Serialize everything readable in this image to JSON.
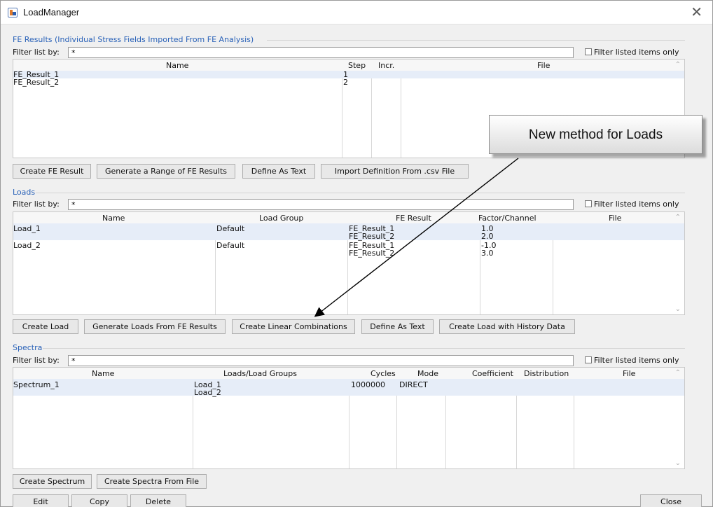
{
  "window": {
    "title": "LoadManager"
  },
  "common": {
    "filter_label": "Filter list by:",
    "filter_value": "*",
    "filter_checkbox_label": "Filter listed items only"
  },
  "fe_results": {
    "title": "FE Results (Individual Stress Fields Imported From FE Analysis)",
    "columns": [
      "Name",
      "Step",
      "Incr.",
      "File"
    ],
    "rows": [
      {
        "name": "FE_Result_1",
        "step": "1",
        "incr": "",
        "file": ""
      },
      {
        "name": "FE_Result_2",
        "step": "2",
        "incr": "",
        "file": ""
      }
    ],
    "buttons": [
      "Create FE Result",
      "Generate a Range of FE Results",
      "Define As Text",
      "Import Definition From .csv File"
    ]
  },
  "loads": {
    "title": "Loads",
    "columns": [
      "Name",
      "Load Group",
      "FE Result",
      "Factor/Channel",
      "File"
    ],
    "rows": [
      {
        "name": "Load_1",
        "group": "Default",
        "fe1": "FE_Result_1",
        "fe2": "FE_Result_2",
        "f1": "1.0",
        "f2": "2.0"
      },
      {
        "name": "Load_2",
        "group": "Default",
        "fe1": "FE_Result_1",
        "fe2": "FE_Result_2",
        "f1": "-1.0",
        "f2": "3.0"
      }
    ],
    "buttons": [
      "Create Load",
      "Generate Loads From FE Results",
      "Create Linear Combinations",
      "Define As Text",
      "Create Load with History Data"
    ]
  },
  "spectra": {
    "title": "Spectra",
    "columns": [
      "Name",
      "Loads/Load Groups",
      "Cycles",
      "Mode",
      "Coefficient",
      "Distribution",
      "File"
    ],
    "rows": [
      {
        "name": "Spectrum_1",
        "load1": "Load_1",
        "load2": "Load_2",
        "cycles": "1000000",
        "mode": "DIRECT"
      }
    ],
    "buttons": [
      "Create Spectrum",
      "Create Spectra From File"
    ]
  },
  "footer": {
    "edit": "Edit",
    "copy": "Copy",
    "delete": "Delete",
    "close": "Close"
  },
  "callout": {
    "text": "New method for Loads"
  }
}
